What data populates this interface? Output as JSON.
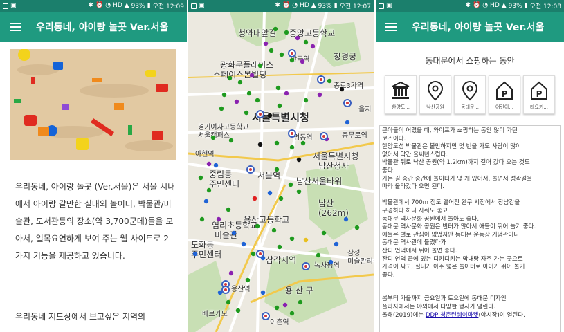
{
  "status_bars": [
    {
      "battery": "93%",
      "time": "오전 12:09"
    },
    {
      "battery": "93%",
      "time": "오전 12:07"
    },
    {
      "battery": "93%",
      "time": "오전 12:08"
    }
  ],
  "app_title": "우리동네, 아이랑 놀곳 Ver.서울",
  "intro": {
    "paragraph": "우리동네, 아이랑 놀곳 (Ver.서울)은 서울 시내에서 아이랑 갈만한 실내외 놀이터, 박물관/미술관, 도서관등의 장소(약 3,700군데)들을 모아서, 일목요연하게 보여 주는 웹 사이트로 2가지 기능을 제공하고 있습니다.",
    "paragraph2": "우리동네  지도상에서 보고싶은 지역의"
  },
  "map": {
    "labels": {
      "cheongwadae": "청와대앞길",
      "jungang_high": "중앙고등학교",
      "gwanghwamun": "광화문플레이스",
      "space_fabric": "스페이스본빌딩",
      "anguk": "안국역",
      "changgyeonggung": "창경궁",
      "jongno3ga": "종로3가역",
      "euljiro": "을지",
      "seoul_city": "서울특별시청",
      "gyeonggi_high": "경기여자고등학교",
      "seoul_campus": "서울캠퍼스",
      "dongdaemun": "명동역",
      "chungmuro": "충무로역",
      "ahyeon": "아현역",
      "seoul_station": "서울역",
      "junggu_office": "중림동\n주민센터",
      "seoul_tukbyeol": "서울특별시청",
      "namsan_chungsa": "남산청사",
      "namsan_tower": "남산서울타워",
      "namsan": "남산\n(262m)",
      "yongsan_high": "용산고등학교",
      "yeomni": "염리초등학교",
      "museum": "미술관",
      "dohwa": "도화동\n주민센터",
      "samgakji": "삼각지역",
      "noksapyeong": "녹사평역",
      "samsung": "삼성\n미술관리움",
      "yongsan_gu": "용 산 구",
      "yongsan": "용산역",
      "bereugabo": "베르가모",
      "ichon": "이촌역"
    },
    "marker_colors": {
      "green": "#1e9a1e",
      "purple": "#8a22b0",
      "blue": "#1f63d6",
      "black": "#111111",
      "red": "#e02020",
      "yellow": "#e8c020"
    }
  },
  "detail": {
    "title": "동대문에서 쇼핑하는 동안",
    "places": [
      {
        "icon": "museum-icon",
        "label": "한양도..."
      },
      {
        "icon": "location-pin-icon",
        "label": "낙산공원"
      },
      {
        "icon": "location-pin-icon",
        "label": "동대문..."
      },
      {
        "icon": "parking-home-icon",
        "label": "어린이..."
      },
      {
        "icon": "parking-home-icon",
        "label": "타요키..."
      }
    ],
    "lines": [
      "큰아들이 어렸을 때, 와이프가 쇼핑하는 동안 많이 가던",
      "코스이다.",
      "한양도성 박물관은 볼만하지만 몇 번을 가도 사람이 많이",
      "없어서 약간 을씨년스럽다.",
      "박물관 뒤로 낙산 공원(약 1.2km)까지 걸어 갔다 오는 것도",
      "좋다.",
      "가는 길 중간 중간에 놀이터가 몇 개 있어서, 놀면서 성곽길을",
      "따라 올라갔다 오면 된다.",
      "",
      "박물관에서 700m 정도 떨어진 완구 시장에서 장남감을",
      "구경하다 하나 사줘도 좋고",
      "동대문 역사문화 공원에서 놀아도 좋다.",
      "동대문 역사문화 공원은 빈터가 많아서 애들이 뛰어 놀기 좋다.",
      "애들은 별로 관심이 없었지만 동대문 운동장 기념관이나",
      "동대문 역사관에 들렸다가",
      "잔디 언덕에서 뛰어 놀면 좋다.",
      "잔디 언덕 끝에 있는 디키디키는 막내랑 자주 가는 곳으로",
      "가격이 싸고, 실내가 아주 넓은 놀이터로 아이가 뛰어 놀기",
      "좋다.",
      "",
      "",
      "봄부터 가을까지 금요일과 토요일에 동대문 디자인",
      "플라자에서는 야외에서 다양한 행사가 열린다."
    ],
    "last_line_prefix": "올해(2019)에는 ",
    "last_line_link": "DDP 청춘런웨이마켓",
    "last_line_suffix": "(야시장)이 열린다."
  }
}
